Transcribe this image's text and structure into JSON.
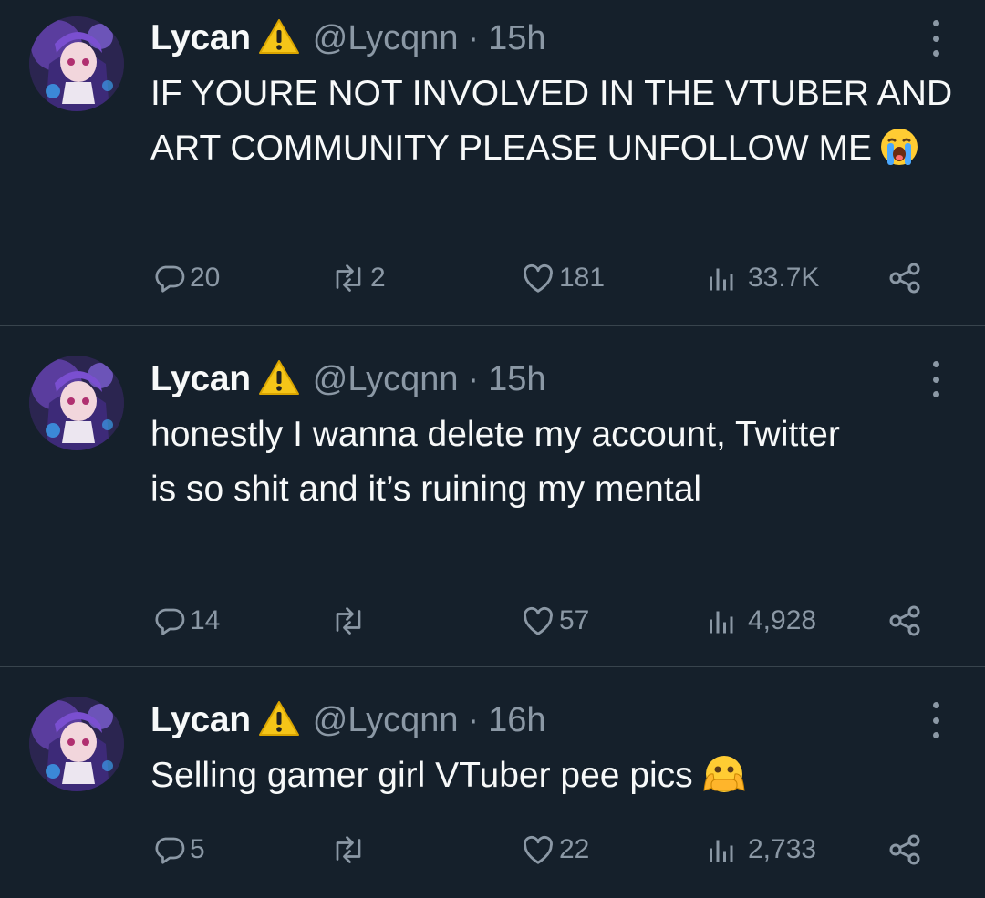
{
  "colors": {
    "background": "#15202b",
    "text": "#f7f9f9",
    "muted": "#8b98a5",
    "divider": "#38444d"
  },
  "tweets": [
    {
      "author": {
        "name": "Lycan",
        "handle": "@Lycqnn",
        "badge_icon": "warning-icon"
      },
      "separator": "·",
      "time": "15h",
      "text": "IF YOURE NOT INVOLVED IN THE VTUBER AND ART COMMUNITY PLEASE UNFOLLOW ME",
      "emoji": "loudly-crying-face",
      "replies": "20",
      "retweets": "2",
      "likes": "181",
      "views": "33.7K"
    },
    {
      "author": {
        "name": "Lycan",
        "handle": "@Lycqnn",
        "badge_icon": "warning-icon"
      },
      "separator": "·",
      "time": "15h",
      "text": "honestly I wanna delete my account, Twitter is so shit and it’s ruining my mental",
      "emoji": "",
      "replies": "14",
      "retweets": "",
      "likes": "57",
      "views": "4,928"
    },
    {
      "author": {
        "name": "Lycan",
        "handle": "@Lycqnn",
        "badge_icon": "warning-icon"
      },
      "separator": "·",
      "time": "16h",
      "text": "Selling gamer girl VTuber pee pics",
      "emoji": "face-with-open-eyes-and-hand-over-mouth",
      "replies": "5",
      "retweets": "",
      "likes": "22",
      "views": "2,733"
    }
  ]
}
